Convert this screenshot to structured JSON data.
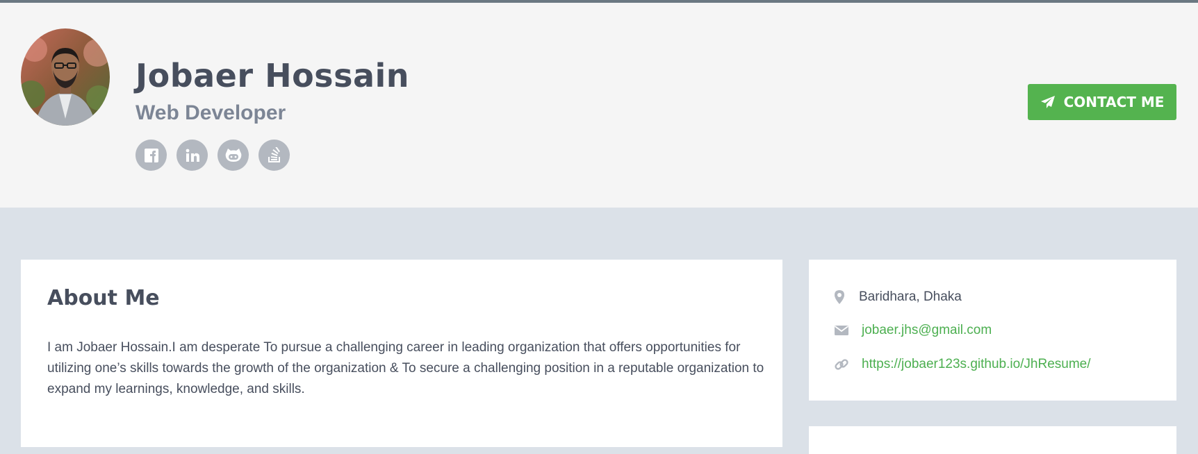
{
  "profile": {
    "name": "Jobaer Hossain",
    "title": "Web Developer"
  },
  "social": [
    {
      "icon": "facebook-icon"
    },
    {
      "icon": "linkedin-icon"
    },
    {
      "icon": "github-icon"
    },
    {
      "icon": "stackoverflow-icon"
    }
  ],
  "contact_button": {
    "label": "CONTACT ME",
    "icon": "paper-plane-icon"
  },
  "about": {
    "heading": "About Me",
    "text": "I am Jobaer Hossain.I am desperate To pursue a challenging career in leading organization that offers opportunities for utilizing one’s skills towards the growth of the organization & To secure a challenging position in a reputable organization to expand my learnings, knowledge, and skills."
  },
  "info": {
    "location": "Baridhara, Dhaka",
    "email": "jobaer.jhs@gmail.com",
    "website": "https://jobaer123s.github.io/JhResume/"
  },
  "colors": {
    "accent": "#54b34f",
    "link": "#4caf50",
    "header_bg": "#f5f5f5",
    "page_bg": "#dbe1e8",
    "text": "#474e5d"
  }
}
